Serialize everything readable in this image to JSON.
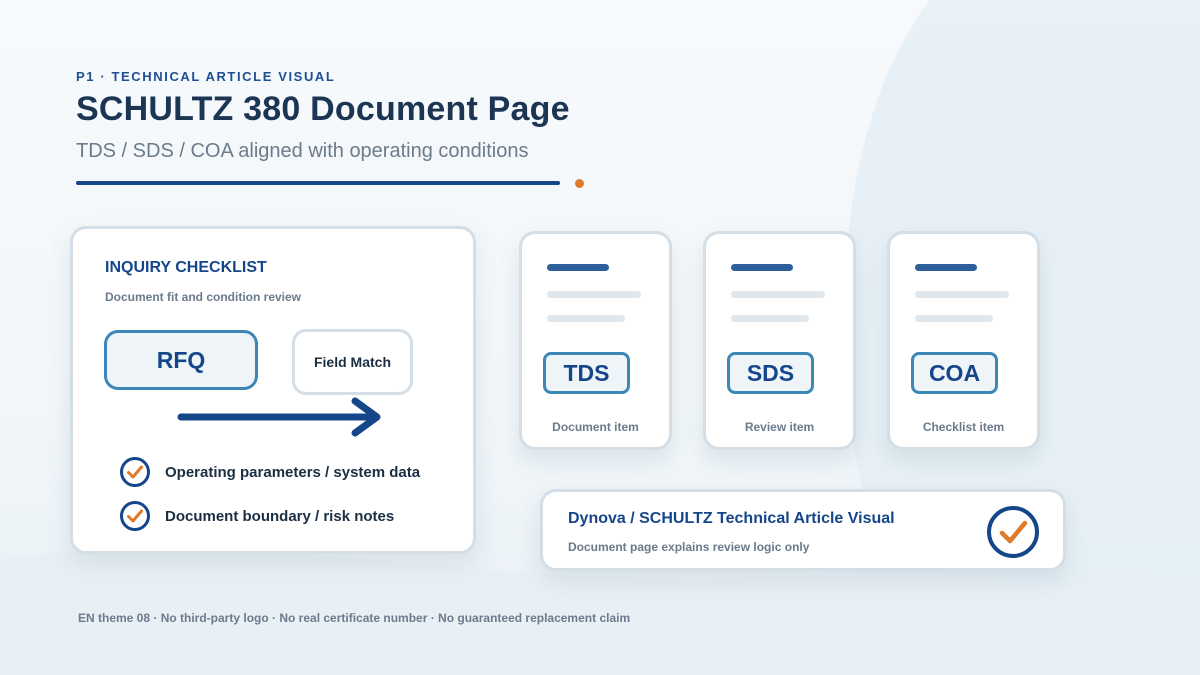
{
  "header": {
    "eyebrow": "P1 · TECHNICAL ARTICLE VISUAL",
    "title": "SCHULTZ 380 Document Page",
    "subtitle": "TDS / SDS / COA aligned with operating conditions"
  },
  "checklist": {
    "title": "INQUIRY CHECKLIST",
    "subtitle": "Document fit and condition review",
    "from_label": "RFQ",
    "to_label": "Field Match",
    "items": [
      {
        "label": "Operating parameters / system data"
      },
      {
        "label": "Document boundary / risk notes"
      }
    ]
  },
  "documents": [
    {
      "tag": "TDS",
      "label": "Document item"
    },
    {
      "tag": "SDS",
      "label": "Review item"
    },
    {
      "tag": "COA",
      "label": "Checklist item"
    }
  ],
  "footer_card": {
    "title": "Dynova / SCHULTZ Technical Article Visual",
    "subtitle": "Document page explains review logic only"
  },
  "disclaimer": "EN theme 08 · No third-party logo · No real certificate number · No guaranteed replacement claim",
  "colors": {
    "brand_navy": "#15468a",
    "accent_orange": "#e07a2b",
    "tag_border": "#3b87b5"
  },
  "icons": {
    "check": "check-circle-icon",
    "arrow": "arrow-right-icon"
  }
}
